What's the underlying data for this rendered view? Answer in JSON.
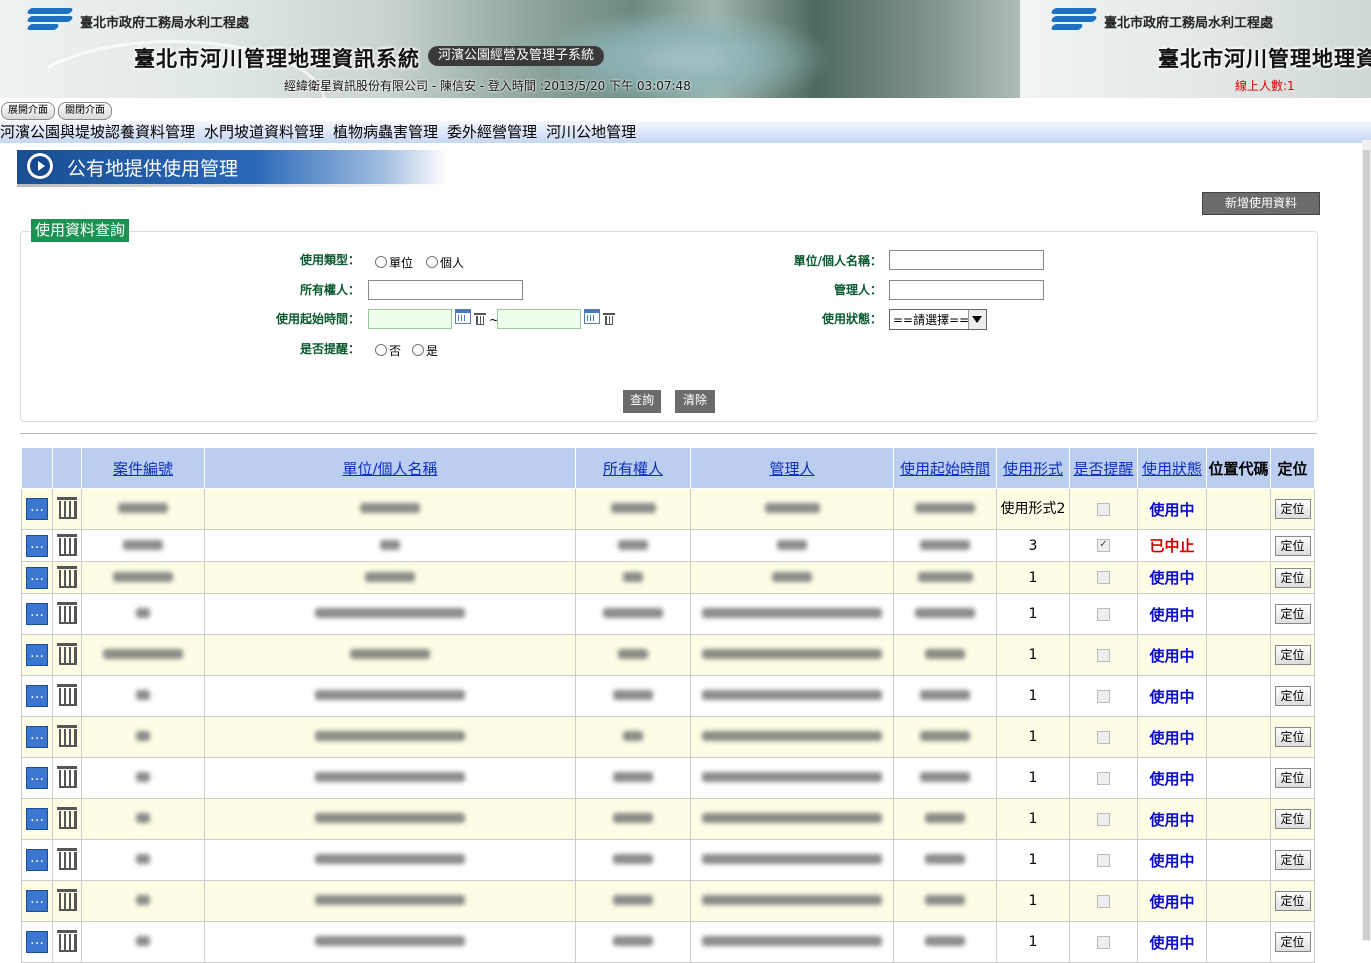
{
  "header": {
    "org": "臺北市政府工務局水利工程處",
    "system_title": "臺北市河川管理地理資訊系統",
    "subsystem": "河濱公園經營及管理子系統",
    "login_info": "經緯衛星資訊股份有限公司 - 陳信安 - 登入時間 :2013/5/20 下午 03:07:48",
    "online_users": "線上人數:1"
  },
  "top_buttons": {
    "open_label": "展開介面",
    "close_label": "關閉介面"
  },
  "menu": [
    "河濱公園與堤坡認養資料管理",
    "水門坡道資料管理",
    "植物病蟲害管理",
    "委外經營管理",
    "河川公地管理"
  ],
  "page_title": "公有地提供使用管理",
  "add_button": "新增使用資料",
  "search": {
    "legend": "使用資料查詢",
    "type_label": "使用類型：",
    "type_options": [
      "單位",
      "個人"
    ],
    "name_label": "單位/個人名稱：",
    "owner_label": "所有權人：",
    "manager_label": "管理人：",
    "start_label": "使用起始時間：",
    "date_sep": "~",
    "status_label": "使用狀態：",
    "status_selected": "==請選擇==",
    "remind_label": "是否提醒：",
    "remind_options": [
      "否",
      "是"
    ],
    "query_button": "查詢",
    "clear_button": "清除"
  },
  "table": {
    "headers": [
      "案件編號",
      "單位/個人名稱",
      "所有權人",
      "管理人",
      "使用起始時間",
      "使用形式",
      "是否提醒",
      "使用狀態",
      "位置代碼",
      "定位"
    ],
    "locate_label": "定位",
    "rows": [
      {
        "form": "使用形式2",
        "remind": false,
        "status": "使用中",
        "active": true
      },
      {
        "form": "3",
        "remind": true,
        "status": "已中止",
        "active": false
      },
      {
        "form": "1",
        "remind": false,
        "status": "使用中",
        "active": true
      },
      {
        "form": "1",
        "remind": false,
        "status": "使用中",
        "active": true
      },
      {
        "form": "1",
        "remind": false,
        "status": "使用中",
        "active": true
      },
      {
        "form": "1",
        "remind": false,
        "status": "使用中",
        "active": true
      },
      {
        "form": "1",
        "remind": false,
        "status": "使用中",
        "active": true
      },
      {
        "form": "1",
        "remind": false,
        "status": "使用中",
        "active": true
      },
      {
        "form": "1",
        "remind": false,
        "status": "使用中",
        "active": true
      },
      {
        "form": "1",
        "remind": false,
        "status": "使用中",
        "active": true
      },
      {
        "form": "1",
        "remind": false,
        "status": "使用中",
        "active": true
      },
      {
        "form": "1",
        "remind": false,
        "status": "使用中",
        "active": true
      }
    ]
  },
  "colors": {
    "header_bg": "#bccdf2",
    "active_status": "#0a0acb",
    "stopped_status": "#d10000",
    "legend_bg": "#1d9353"
  }
}
